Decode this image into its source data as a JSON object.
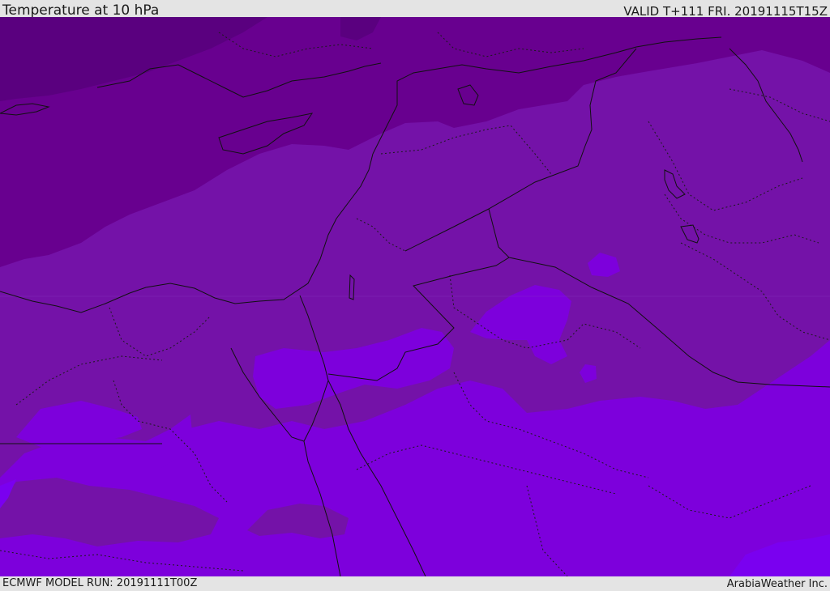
{
  "header": {
    "title": "Temperature at 10 hPa",
    "valid": "VALID T+111 FRI. 20191115T15Z"
  },
  "footer": {
    "model_run": "ECMWF MODEL RUN: 20191111T00Z",
    "credit": "ArabiaWeather Inc."
  },
  "map": {
    "colors": {
      "darkest": "#5a007f",
      "dark": "#68008f",
      "mid": "#7412a8",
      "mid_light": "#7a0fc4",
      "light": "#7d00dc",
      "lightest": "#7a00f0",
      "border": "#111111"
    }
  }
}
